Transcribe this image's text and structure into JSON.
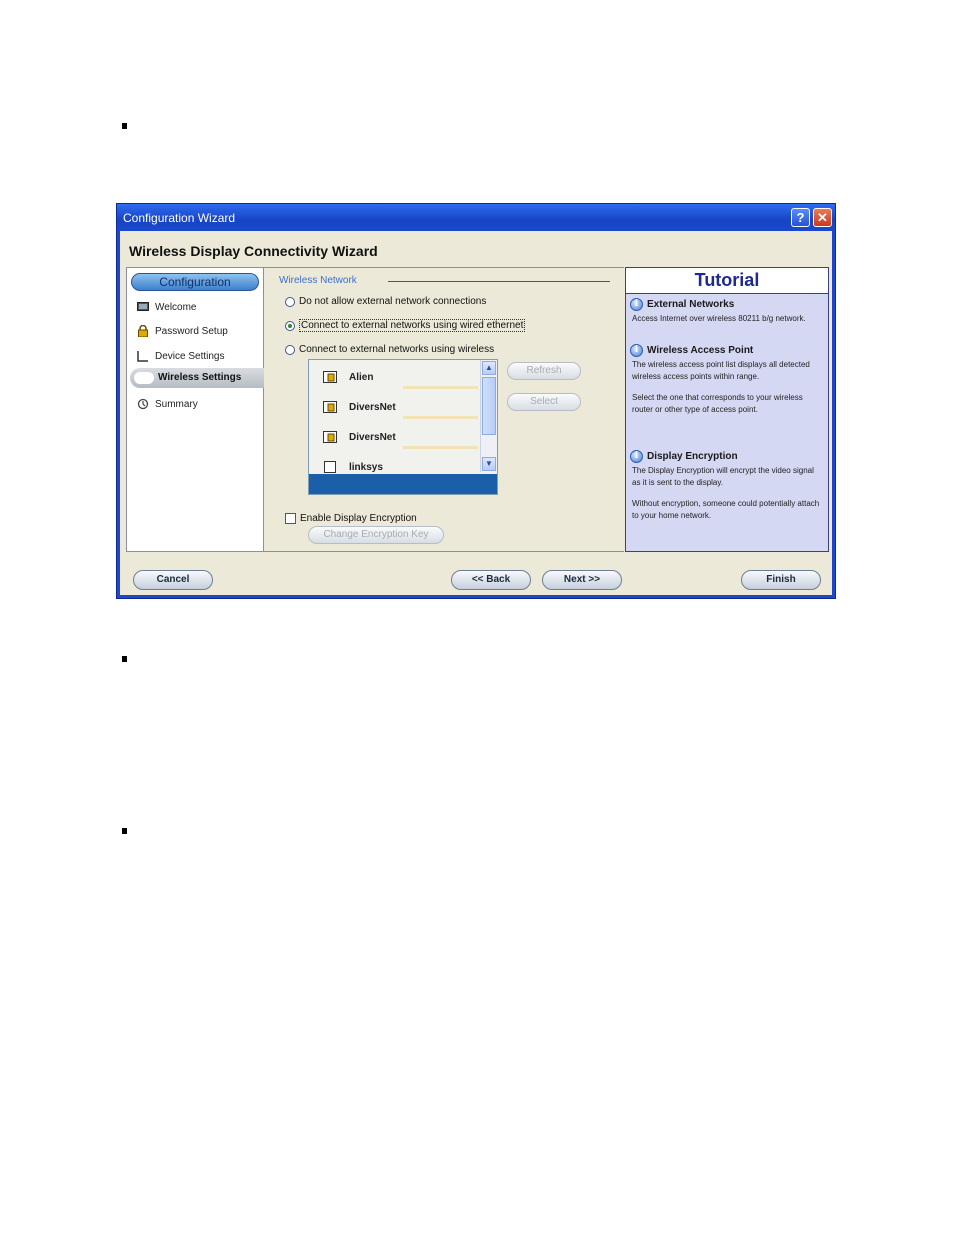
{
  "window": {
    "title": "Configuration Wizard",
    "help_glyph": "?",
    "close_glyph": "✕",
    "heading": "Wireless Display Connectivity Wizard"
  },
  "nav": {
    "header": "Configuration",
    "items": [
      {
        "label": "Welcome",
        "icon": "monitor-icon"
      },
      {
        "label": "Password Setup",
        "icon": "lock-icon"
      },
      {
        "label": "Device Settings",
        "icon": "device-icon"
      },
      {
        "label": "Wireless Settings",
        "icon": "active-indicator"
      },
      {
        "label": "Summary",
        "icon": "summary-icon"
      }
    ],
    "active_index": 3
  },
  "wireless": {
    "group_label": "Wireless Network",
    "options": [
      {
        "label": "Do not allow external network connections",
        "selected": false
      },
      {
        "label": "Connect to external networks using wired ethernet",
        "selected": true
      },
      {
        "label": "Connect to external networks using wireless",
        "selected": false
      }
    ],
    "access_points": [
      {
        "name": "Alien",
        "secured": true
      },
      {
        "name": "DiversNet",
        "secured": true
      },
      {
        "name": "DiversNet",
        "secured": true
      },
      {
        "name": "linksys",
        "secured": false
      }
    ],
    "refresh_label": "Refresh",
    "select_label": "Select",
    "encryption_label": "Enable Display Encryption",
    "encryption_checked": false,
    "change_key_label": "Change Encryption Key"
  },
  "tutorial": {
    "title": "Tutorial",
    "sections": [
      {
        "heading": "External Networks",
        "text": "Access Internet over wireless 80211 b/g network."
      },
      {
        "heading": "Wireless Access Point",
        "text": "The wireless access point list displays all detected wireless access points within range.",
        "text2": "Select the one that corresponds to your wireless router or other type of access point."
      },
      {
        "heading": "Display Encryption",
        "text": "The Display Encryption will encrypt the video signal as it is sent to the display.",
        "text2": "Without encryption, someone could potentially attach to your home network."
      }
    ]
  },
  "footer": {
    "cancel_label": "Cancel",
    "back_label": "<< Back",
    "next_label": "Next >>",
    "finish_label": "Finish"
  },
  "colors": {
    "titlebar": "#1f47c7",
    "client_bg": "#ece9d8",
    "tutorial_bg": "#d5d8f3",
    "selection": "#1c5fa9"
  }
}
